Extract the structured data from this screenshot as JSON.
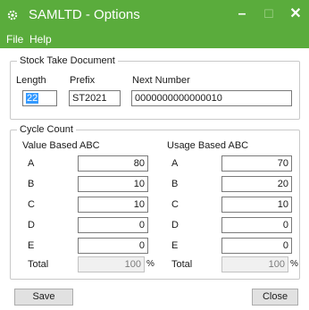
{
  "window": {
    "title": "SAMLTD - Options",
    "min_glyph": "–",
    "max_glyph": "☐",
    "close_glyph": "✕",
    "icon": "gear-icon",
    "accent": "#5aac3c"
  },
  "menu": {
    "file": "File",
    "help": "Help"
  },
  "stock_take": {
    "legend": "Stock Take Document",
    "length_label": "Length",
    "prefix_label": "Prefix",
    "next_number_label": "Next Number",
    "length_value": "22",
    "prefix_value": "ST2021",
    "next_number_value": "0000000000000010"
  },
  "cycle_count": {
    "legend": "Cycle Count",
    "value_header": "Value Based ABC",
    "usage_header": "Usage Based ABC",
    "rows": [
      {
        "label": "A",
        "value": "80",
        "usage": "70"
      },
      {
        "label": "B",
        "value": "10",
        "usage": "20"
      },
      {
        "label": "C",
        "value": "10",
        "usage": "10"
      },
      {
        "label": "D",
        "value": "0",
        "usage": "0"
      },
      {
        "label": "E",
        "value": "0",
        "usage": "0"
      }
    ],
    "total_label": "Total",
    "value_total": "100",
    "usage_total": "100",
    "percent": "%"
  },
  "buttons": {
    "save": "Save",
    "close": "Close"
  }
}
